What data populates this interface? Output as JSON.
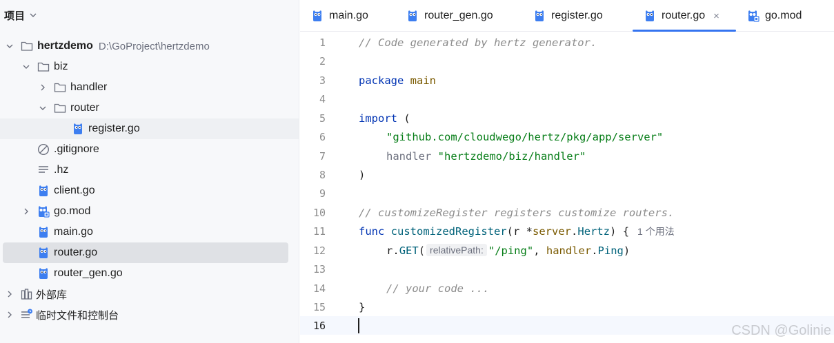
{
  "project_panel": {
    "title": "项目",
    "tree": [
      {
        "label": "hertzdemo",
        "path": "D:\\GoProject\\hertzdemo",
        "icon": "folder-icon",
        "expanded": true
      },
      {
        "label": "biz",
        "icon": "folder-icon",
        "expanded": true
      },
      {
        "label": "handler",
        "icon": "folder-icon",
        "expanded": false
      },
      {
        "label": "router",
        "icon": "folder-icon",
        "expanded": true
      },
      {
        "label": "register.go",
        "icon": "go-file-icon"
      },
      {
        "label": ".gitignore",
        "icon": "ignore-file-icon"
      },
      {
        "label": ".hz",
        "icon": "text-file-icon"
      },
      {
        "label": "client.go",
        "icon": "go-file-icon"
      },
      {
        "label": "go.mod",
        "icon": "go-mod-icon",
        "expanded": false
      },
      {
        "label": "main.go",
        "icon": "go-file-icon"
      },
      {
        "label": "router.go",
        "icon": "go-file-icon",
        "selected": true
      },
      {
        "label": "router_gen.go",
        "icon": "go-file-icon"
      },
      {
        "label": "外部库",
        "icon": "library-icon",
        "expanded": false
      },
      {
        "label": "临时文件和控制台",
        "icon": "scratches-icon",
        "expanded": false
      }
    ]
  },
  "tabs": [
    {
      "label": "main.go",
      "icon": "go-file-icon"
    },
    {
      "label": "router_gen.go",
      "icon": "go-file-icon"
    },
    {
      "label": "register.go",
      "icon": "go-file-icon"
    },
    {
      "label": "router.go",
      "icon": "go-file-icon",
      "active": true,
      "close": "×"
    },
    {
      "label": "go.mod",
      "icon": "go-mod-icon"
    }
  ],
  "editor": {
    "line_numbers": [
      "1",
      "2",
      "3",
      "4",
      "5",
      "6",
      "7",
      "8",
      "9",
      "10",
      "11",
      "12",
      "13",
      "14",
      "15",
      "16"
    ],
    "current_line": "16",
    "code": {
      "l1": "// Code generated by hertz generator.",
      "l3_kw": "package",
      "l3_name": "main",
      "l5_kw": "import",
      "l5_paren": " (",
      "l6_str": "\"github.com/cloudwego/hertz/pkg/app/server\"",
      "l7_alias": "handler",
      "l7_str": "\"hertzdemo/biz/handler\"",
      "l8": ")",
      "l10": "// customizeRegister registers customize routers.",
      "l11_kw": "func",
      "l11_fn": "customizedRegister",
      "l11_open": "(",
      "l11_param": "r",
      "l11_star": " *",
      "l11_pkg": "server",
      "l11_dot": ".",
      "l11_type": "Hertz",
      "l11_close": ") {",
      "l11_usage": "1 个用法",
      "l12_recv": "r",
      "l12_dot": ".",
      "l12_method": "GET",
      "l12_open": "(",
      "l12_hint": "relativePath:",
      "l12_str": "\"/ping\"",
      "l12_comma": ", ",
      "l12_pkg": "handler",
      "l12_dot2": ".",
      "l12_fn": "Ping",
      "l12_close": ")",
      "l14": "// your code ...",
      "l15": "}"
    }
  },
  "watermark": "CSDN @Golinie",
  "colors": {
    "accent": "#3574f0",
    "keyword": "#0033b3",
    "string": "#067d17",
    "comment": "#8c8c8c",
    "gopher": "#3d7ef0"
  }
}
